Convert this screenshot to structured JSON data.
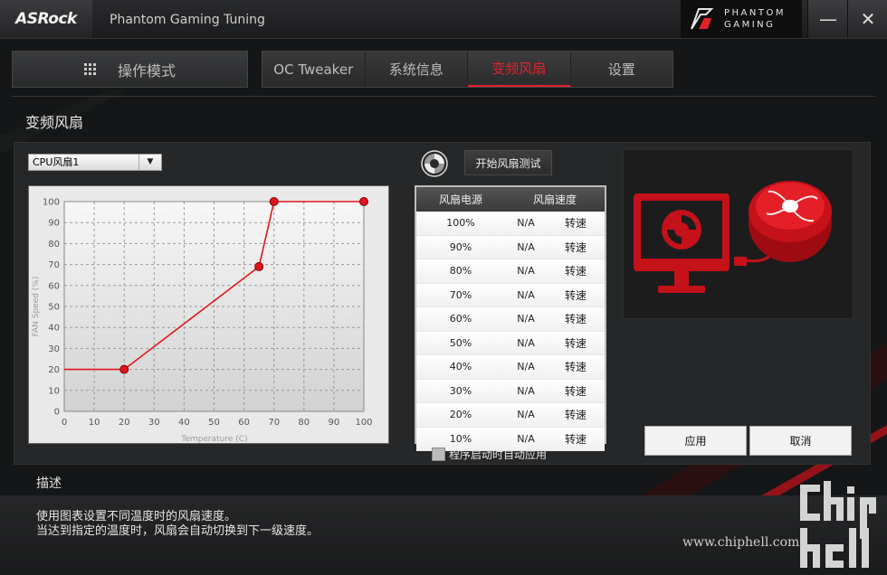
{
  "titlebar": {
    "brand": "ASRock",
    "app_title": "Phantom Gaming Tuning",
    "pg_line1": "PHANTOM",
    "pg_line2": "GAMING",
    "minimize": "—",
    "close": "✕"
  },
  "nav": {
    "mode_label": "操作模式",
    "tabs": [
      {
        "label": "OC Tweaker",
        "active": false
      },
      {
        "label": "系统信息",
        "active": false
      },
      {
        "label": "变频风扇",
        "active": true
      },
      {
        "label": "设置",
        "active": false
      }
    ]
  },
  "page_title": "变频风扇",
  "fan_select": {
    "value": "CPU风扇1"
  },
  "chart_data": {
    "type": "line",
    "x": [
      0,
      20,
      65,
      70,
      100
    ],
    "y": [
      20,
      20,
      69,
      100,
      100
    ],
    "marker_points": [
      [
        20,
        20
      ],
      [
        65,
        69
      ],
      [
        70,
        100
      ],
      [
        100,
        100
      ]
    ],
    "xlabel": "Temperature (C)",
    "ylabel": "FAN Speed (%)",
    "xlim": [
      0,
      100
    ],
    "ylim": [
      0,
      100
    ],
    "xticks": [
      0,
      10,
      20,
      30,
      40,
      50,
      60,
      70,
      80,
      90,
      100
    ],
    "yticks": [
      0,
      10,
      20,
      30,
      40,
      50,
      60,
      70,
      80,
      90,
      100
    ],
    "grid": true,
    "line_color": "#e0151b"
  },
  "fan_test": {
    "button_label": "开始风扇测试",
    "icon": "spin-fan-icon"
  },
  "table": {
    "headers": [
      "风扇电源",
      "风扇速度"
    ],
    "rows": [
      {
        "power": "100%",
        "speed": "N/A",
        "unit": "转速"
      },
      {
        "power": "90%",
        "speed": "N/A",
        "unit": "转速"
      },
      {
        "power": "80%",
        "speed": "N/A",
        "unit": "转速"
      },
      {
        "power": "70%",
        "speed": "N/A",
        "unit": "转速"
      },
      {
        "power": "60%",
        "speed": "N/A",
        "unit": "转速"
      },
      {
        "power": "50%",
        "speed": "N/A",
        "unit": "转速"
      },
      {
        "power": "40%",
        "speed": "N/A",
        "unit": "转速"
      },
      {
        "power": "30%",
        "speed": "N/A",
        "unit": "转速"
      },
      {
        "power": "20%",
        "speed": "N/A",
        "unit": "转速"
      },
      {
        "power": "10%",
        "speed": "N/A",
        "unit": "转速"
      }
    ]
  },
  "autostart": {
    "label": "程序启动时自动应用",
    "checked": false
  },
  "actions": {
    "apply": "应用",
    "cancel": "取消"
  },
  "description": {
    "title": "描述",
    "line1": "使用图表设置不同温度时的风扇速度。",
    "line2": "当达到指定的温度时，风扇会自动切换到下一级速度。"
  },
  "watermark": {
    "url": "www.chiphell.com",
    "logo": "chiphell-logo"
  },
  "colors": {
    "accent": "#e2232a",
    "panel": "#262728",
    "bg": "#151617"
  }
}
